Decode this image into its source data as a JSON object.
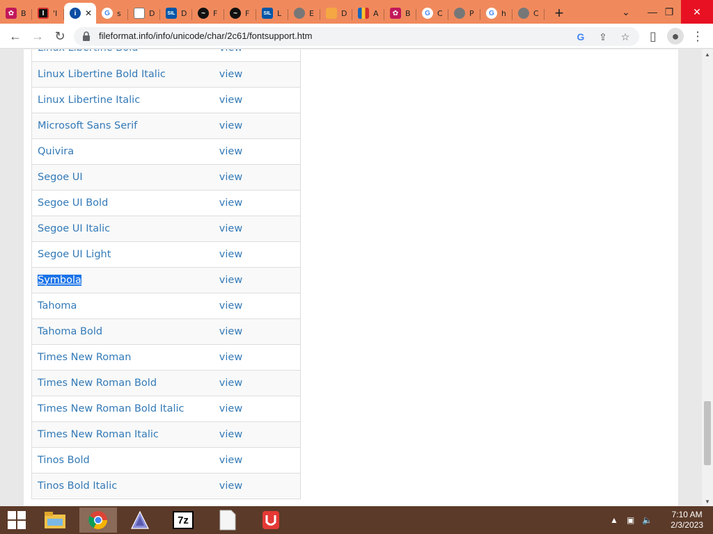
{
  "browser": {
    "tabs": [
      {
        "letter": "B",
        "icon": "flower-icon",
        "color": "#c2185b"
      },
      {
        "letter": "'I",
        "icon": "red-box-icon",
        "color": "#d32f2f"
      },
      {
        "letter": "",
        "icon": "info-icon",
        "color": "#0b4da2",
        "active": true
      },
      {
        "letter": "s",
        "icon": "google-icon",
        "color": "#4285f4"
      },
      {
        "letter": "D",
        "icon": "document-icon",
        "color": "#ffffff"
      },
      {
        "letter": "D",
        "icon": "sil-icon",
        "color": "#0057a8"
      },
      {
        "letter": "F",
        "icon": "feather-icon",
        "color": "#111111"
      },
      {
        "letter": "F",
        "icon": "feather-icon",
        "color": "#111111"
      },
      {
        "letter": "L",
        "icon": "sil-icon",
        "color": "#0057a8"
      },
      {
        "letter": "E",
        "icon": "globe-icon",
        "color": "#777777"
      },
      {
        "letter": "D",
        "icon": "orange-icon",
        "color": "#f4a742"
      },
      {
        "letter": "A",
        "icon": "flag-icon",
        "color": "#2e7d32"
      },
      {
        "letter": "B",
        "icon": "flower-icon",
        "color": "#c2185b"
      },
      {
        "letter": "C",
        "icon": "google-icon",
        "color": "#4285f4"
      },
      {
        "letter": "P",
        "icon": "globe-icon",
        "color": "#777777"
      },
      {
        "letter": "h",
        "icon": "google-icon",
        "color": "#4285f4"
      },
      {
        "letter": "C",
        "icon": "globe-icon",
        "color": "#777777"
      }
    ],
    "new_tab": "+",
    "url": "fileformat.info/info/unicode/char/2c61/fontsupport.htm"
  },
  "fonts": {
    "top_partial": {
      "name": "Linux Libertine Bold",
      "link": "view"
    },
    "rows": [
      {
        "name": "Linux Libertine Bold Italic",
        "link": "view"
      },
      {
        "name": "Linux Libertine Italic",
        "link": "view"
      },
      {
        "name": "Microsoft Sans Serif",
        "link": "view"
      },
      {
        "name": "Quivira",
        "link": "view"
      },
      {
        "name": "Segoe UI",
        "link": "view"
      },
      {
        "name": "Segoe UI Bold",
        "link": "view"
      },
      {
        "name": "Segoe UI Italic",
        "link": "view"
      },
      {
        "name": "Segoe UI Light",
        "link": "view"
      },
      {
        "name": "Symbola",
        "link": "view",
        "selected": true
      },
      {
        "name": "Tahoma",
        "link": "view"
      },
      {
        "name": "Tahoma Bold",
        "link": "view"
      },
      {
        "name": "Times New Roman",
        "link": "view"
      },
      {
        "name": "Times New Roman Bold",
        "link": "view"
      },
      {
        "name": "Times New Roman Bold Italic",
        "link": "view"
      },
      {
        "name": "Times New Roman Italic",
        "link": "view"
      },
      {
        "name": "Tinos Bold",
        "link": "view"
      },
      {
        "name": "Tinos Bold Italic",
        "link": "view"
      }
    ]
  },
  "taskbar": {
    "apps": [
      "file-explorer-icon",
      "chrome-icon",
      "inkscape-icon",
      "7zip-icon",
      "notepad-icon",
      "app-icon"
    ],
    "sevenzip_label": "7z",
    "time": "7:10 AM",
    "date": "2/3/2023"
  }
}
